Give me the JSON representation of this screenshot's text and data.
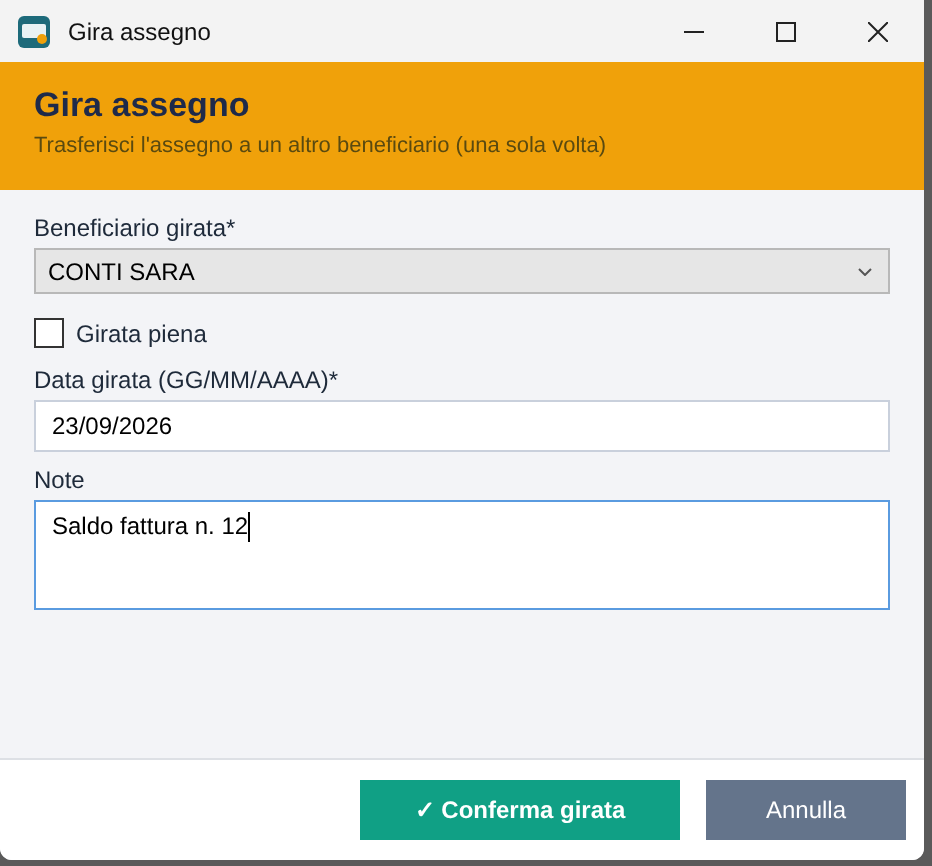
{
  "window": {
    "title": "Gira assegno"
  },
  "header": {
    "title": "Gira assegno",
    "subtitle": "Trasferisci l'assegno a un altro beneficiario (una sola volta)"
  },
  "fields": [
    {
      "kind": "select",
      "label": "Beneficiario girata*",
      "value": "CONTI SARA"
    },
    {
      "kind": "checkbox",
      "label": "Girata piena",
      "checked": false
    },
    {
      "kind": "text",
      "label": "Data girata (GG/MM/AAAA)*",
      "value": "23/09/2026"
    },
    {
      "kind": "textarea",
      "label": "Note",
      "value": "Saldo fattura n. 12",
      "focused": true
    }
  ],
  "buttons": [
    {
      "kind": "primary",
      "label": "✓ Conferma girata"
    },
    {
      "kind": "secondary",
      "label": "Annulla"
    }
  ]
}
